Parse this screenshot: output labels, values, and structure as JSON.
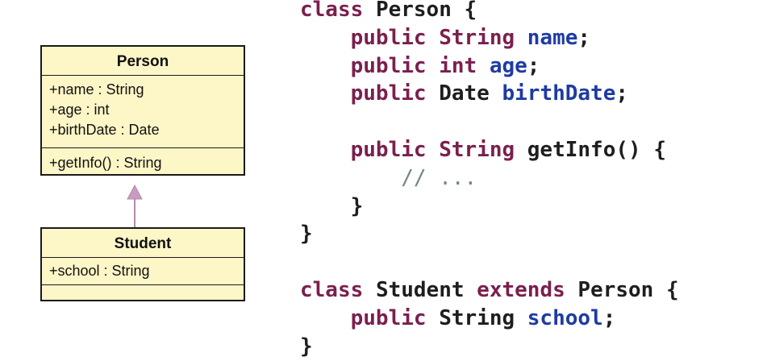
{
  "uml": {
    "person": {
      "name": "Person",
      "attributes": [
        "+name : String",
        "+age : int",
        "+birthDate : Date"
      ],
      "methods": [
        "+getInfo() : String"
      ]
    },
    "student": {
      "name": "Student",
      "attributes": [
        "+school : String"
      ],
      "methods": []
    }
  },
  "code": {
    "person_class_keyword": "class",
    "person_class_name": "Person",
    "open_brace": "{",
    "close_brace": "}",
    "public_keyword": "public",
    "type_string": "String",
    "type_int": "int",
    "type_date": "Date",
    "field_name": "name",
    "field_age": "age",
    "field_birthdate": "birthDate",
    "semicolon": ";",
    "method_name": "getInfo",
    "method_parens": "()",
    "comment": "// ...",
    "student_class_keyword": "class",
    "student_class_name": "Student",
    "extends_keyword": "extends",
    "extends_target": "Person",
    "field_school": "school"
  },
  "colors": {
    "keyword": "#7b1f4e",
    "field": "#1f3ba3",
    "comment": "#6f8a78",
    "uml_fill": "#fdf6c7",
    "arrow": "#b48aac"
  }
}
